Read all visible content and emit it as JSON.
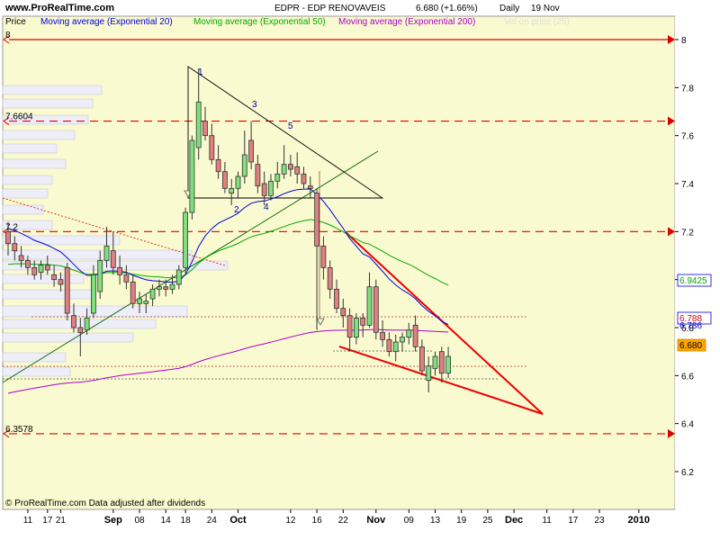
{
  "header": {
    "site": "www.ProRealTime.com",
    "title": "EDPR - EDP RENOVAVEIS",
    "price": "6.680 (+1.66%)",
    "period": "Daily",
    "date": "19 Nov"
  },
  "footer": {
    "credit": "© ProRealTime.com  Data adjusted after dividends"
  },
  "colors": {
    "background": "#fafad0",
    "ema20": "#0000dd",
    "ema50": "#00aa00",
    "ema200": "#aa00cc",
    "up": "#7fe07f",
    "down": "#e08080",
    "level_line": "#dd0000",
    "trend": "#006600"
  },
  "chart_data": {
    "type": "candlestick",
    "title": "EDPR - EDP RENOVAVEIS",
    "ylim": [
      6.08,
      8.15
    ],
    "y_ticks": [
      "8",
      "7.8",
      "7.6",
      "7.4",
      "7.2",
      "7",
      "6.8",
      "6.6",
      "6.4",
      "6.2"
    ],
    "x_tick_labels": [
      "11",
      "17",
      "21",
      "Sep",
      "08",
      "14",
      "18",
      "24",
      "Oct",
      "12",
      "16",
      "22",
      "Nov",
      "09",
      "13",
      "19",
      "25",
      "Dec",
      "11",
      "17",
      "23",
      "2010"
    ],
    "legend": [
      {
        "name": "Price"
      },
      {
        "name": "Moving average (Exponential 20)"
      },
      {
        "name": "Moving average (Exponential 50)"
      },
      {
        "name": "Moving average (Exponential 200)"
      },
      {
        "name": "Vol on price (25)"
      }
    ],
    "last_values": {
      "ema20": "6.9425",
      "ema200": "6.788",
      "price": "6.680",
      "ema50": "6.786"
    },
    "levels": [
      {
        "label": "8",
        "value": 8.0
      },
      {
        "label": "7.6604",
        "value": 7.6604
      },
      {
        "label": "7.2",
        "value": 7.2
      },
      {
        "label": "6.3578",
        "value": 6.3578
      }
    ],
    "wave_labels": [
      "1",
      "2",
      "3",
      "4",
      "5"
    ],
    "candles": [
      {
        "o": 7.2,
        "h": 7.24,
        "l": 7.1,
        "c": 7.15
      },
      {
        "o": 7.15,
        "h": 7.18,
        "l": 7.08,
        "c": 7.12
      },
      {
        "o": 7.1,
        "h": 7.14,
        "l": 7.05,
        "c": 7.08
      },
      {
        "o": 7.08,
        "h": 7.1,
        "l": 7.02,
        "c": 7.05
      },
      {
        "o": 7.05,
        "h": 7.08,
        "l": 7.0,
        "c": 7.02
      },
      {
        "o": 7.03,
        "h": 7.08,
        "l": 7.0,
        "c": 7.06
      },
      {
        "o": 7.06,
        "h": 7.1,
        "l": 7.02,
        "c": 7.04
      },
      {
        "o": 7.02,
        "h": 7.06,
        "l": 6.97,
        "c": 7.0
      },
      {
        "o": 7.0,
        "h": 7.03,
        "l": 6.95,
        "c": 6.98
      },
      {
        "o": 7.05,
        "h": 7.07,
        "l": 6.83,
        "c": 6.86
      },
      {
        "o": 6.85,
        "h": 6.9,
        "l": 6.78,
        "c": 6.8
      },
      {
        "o": 6.8,
        "h": 6.84,
        "l": 6.68,
        "c": 6.78
      },
      {
        "o": 6.79,
        "h": 6.88,
        "l": 6.77,
        "c": 6.84
      },
      {
        "o": 6.86,
        "h": 7.06,
        "l": 6.84,
        "c": 7.02
      },
      {
        "o": 6.95,
        "h": 7.12,
        "l": 6.92,
        "c": 7.08
      },
      {
        "o": 7.08,
        "h": 7.22,
        "l": 7.05,
        "c": 7.14
      },
      {
        "o": 7.12,
        "h": 7.2,
        "l": 7.02,
        "c": 7.05
      },
      {
        "o": 7.05,
        "h": 7.1,
        "l": 6.98,
        "c": 7.02
      },
      {
        "o": 7.02,
        "h": 7.06,
        "l": 6.96,
        "c": 6.99
      },
      {
        "o": 6.99,
        "h": 7.02,
        "l": 6.88,
        "c": 6.9
      },
      {
        "o": 6.9,
        "h": 6.95,
        "l": 6.86,
        "c": 6.92
      },
      {
        "o": 6.9,
        "h": 6.94,
        "l": 6.86,
        "c": 6.91
      },
      {
        "o": 6.92,
        "h": 6.98,
        "l": 6.89,
        "c": 6.96
      },
      {
        "o": 6.96,
        "h": 7.0,
        "l": 6.93,
        "c": 6.97
      },
      {
        "o": 6.97,
        "h": 7.0,
        "l": 6.93,
        "c": 6.96
      },
      {
        "o": 6.96,
        "h": 7.02,
        "l": 6.94,
        "c": 6.98
      },
      {
        "o": 6.98,
        "h": 7.06,
        "l": 6.96,
        "c": 7.04
      },
      {
        "o": 7.05,
        "h": 7.3,
        "l": 7.02,
        "c": 7.28
      },
      {
        "o": 7.28,
        "h": 7.6,
        "l": 7.25,
        "c": 7.58
      },
      {
        "o": 7.55,
        "h": 7.88,
        "l": 7.5,
        "c": 7.74
      },
      {
        "o": 7.66,
        "h": 7.72,
        "l": 7.58,
        "c": 7.6
      },
      {
        "o": 7.6,
        "h": 7.65,
        "l": 7.48,
        "c": 7.5
      },
      {
        "o": 7.5,
        "h": 7.56,
        "l": 7.42,
        "c": 7.45
      },
      {
        "o": 7.45,
        "h": 7.49,
        "l": 7.36,
        "c": 7.38
      },
      {
        "o": 7.36,
        "h": 7.42,
        "l": 7.31,
        "c": 7.38
      },
      {
        "o": 7.38,
        "h": 7.45,
        "l": 7.34,
        "c": 7.43
      },
      {
        "o": 7.43,
        "h": 7.62,
        "l": 7.4,
        "c": 7.52
      },
      {
        "o": 7.58,
        "h": 7.66,
        "l": 7.46,
        "c": 7.49
      },
      {
        "o": 7.48,
        "h": 7.52,
        "l": 7.36,
        "c": 7.39
      },
      {
        "o": 7.4,
        "h": 7.45,
        "l": 7.31,
        "c": 7.35
      },
      {
        "o": 7.35,
        "h": 7.44,
        "l": 7.33,
        "c": 7.41
      },
      {
        "o": 7.41,
        "h": 7.49,
        "l": 7.38,
        "c": 7.44
      },
      {
        "o": 7.44,
        "h": 7.56,
        "l": 7.42,
        "c": 7.48
      },
      {
        "o": 7.48,
        "h": 7.52,
        "l": 7.43,
        "c": 7.46
      },
      {
        "o": 7.47,
        "h": 7.53,
        "l": 7.4,
        "c": 7.44
      },
      {
        "o": 7.44,
        "h": 7.47,
        "l": 7.38,
        "c": 7.4
      },
      {
        "o": 7.39,
        "h": 7.43,
        "l": 7.34,
        "c": 7.38
      },
      {
        "o": 7.36,
        "h": 7.38,
        "l": 6.79,
        "c": 7.14
      },
      {
        "o": 7.14,
        "h": 7.18,
        "l": 7.0,
        "c": 7.05
      },
      {
        "o": 7.05,
        "h": 7.08,
        "l": 6.92,
        "c": 6.96
      },
      {
        "o": 6.96,
        "h": 7.0,
        "l": 6.86,
        "c": 6.88
      },
      {
        "o": 6.88,
        "h": 6.92,
        "l": 6.8,
        "c": 6.85
      },
      {
        "o": 6.85,
        "h": 6.88,
        "l": 6.7,
        "c": 6.76
      },
      {
        "o": 6.76,
        "h": 6.86,
        "l": 6.73,
        "c": 6.84
      },
      {
        "o": 6.84,
        "h": 6.86,
        "l": 6.76,
        "c": 6.81
      },
      {
        "o": 6.81,
        "h": 7.03,
        "l": 6.8,
        "c": 6.97
      },
      {
        "o": 6.97,
        "h": 7.0,
        "l": 6.75,
        "c": 6.78
      },
      {
        "o": 6.78,
        "h": 6.83,
        "l": 6.72,
        "c": 6.75
      },
      {
        "o": 6.75,
        "h": 6.78,
        "l": 6.68,
        "c": 6.7
      },
      {
        "o": 6.7,
        "h": 6.77,
        "l": 6.66,
        "c": 6.74
      },
      {
        "o": 6.74,
        "h": 6.78,
        "l": 6.7,
        "c": 6.76
      },
      {
        "o": 6.76,
        "h": 6.82,
        "l": 6.73,
        "c": 6.79
      },
      {
        "o": 6.81,
        "h": 6.85,
        "l": 6.7,
        "c": 6.72
      },
      {
        "o": 6.72,
        "h": 6.75,
        "l": 6.6,
        "c": 6.62
      },
      {
        "o": 6.58,
        "h": 6.68,
        "l": 6.53,
        "c": 6.64
      },
      {
        "o": 6.63,
        "h": 6.7,
        "l": 6.6,
        "c": 6.68
      },
      {
        "o": 6.7,
        "h": 6.72,
        "l": 6.57,
        "c": 6.61
      },
      {
        "o": 6.61,
        "h": 6.72,
        "l": 6.59,
        "c": 6.68
      }
    ]
  }
}
